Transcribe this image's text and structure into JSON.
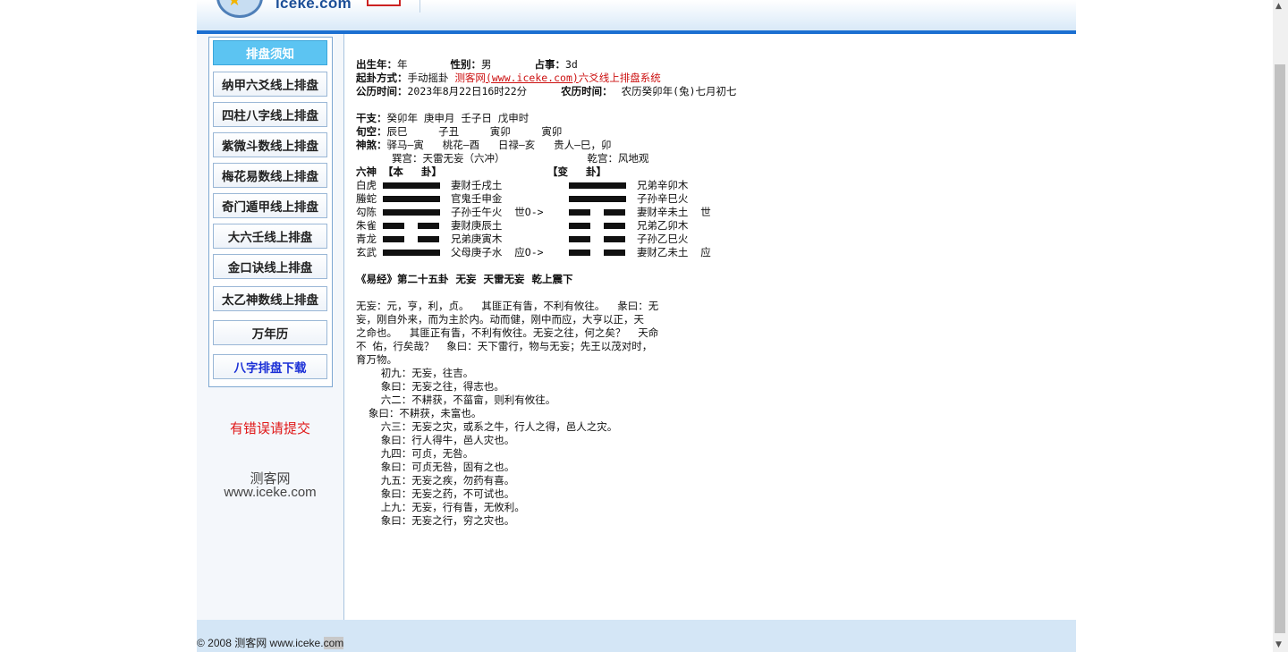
{
  "header": {
    "logo_text": "iceke.com"
  },
  "sidebar": {
    "nav": [
      {
        "label": "排盘须知"
      },
      {
        "label": "纳甲六爻线上排盘"
      },
      {
        "label": "四柱八字线上排盘"
      },
      {
        "label": "紫微斗数线上排盘"
      },
      {
        "label": "梅花易数线上排盘"
      },
      {
        "label": "奇门遁甲线上排盘"
      },
      {
        "label": "大六壬线上排盘"
      },
      {
        "label": "金口诀线上排盘"
      },
      {
        "label": "太乙神数线上排盘"
      },
      {
        "label": "万年历"
      },
      {
        "label": "八字排盘下载"
      }
    ],
    "report_link": "有错误请提交",
    "site_name": "测客网",
    "site_url": "www.iceke.com"
  },
  "info": {
    "birth_year_label": "出生年：",
    "birth_year": "年",
    "gender_label": "性别：",
    "gender": "男",
    "matter_label": "占事：",
    "matter": "3d",
    "method_label": "起卦方式：",
    "method": "手动摇卦",
    "system_prefix": "测客网",
    "system_url": "(www.iceke.com)",
    "system_suffix": "六爻线上排盘系统",
    "solar_label": "公历时间：",
    "solar": "2023年8月22日16时22分",
    "lunar_label": "农历时间：",
    "lunar": "农历癸卯年(兔)七月初七",
    "ganzhi_label": "干支：",
    "ganzhi": "癸卯年 庚申月 壬子日 戊申时",
    "xunkong_label": "旬空：",
    "xunkong": "辰巳     子丑     寅卯     寅卯",
    "shensha_label": "神煞：",
    "shensha": "驿马—寅   桃花—酉   日禄—亥   贵人—巳，卯",
    "palace_main": "巽宫：天雷无妄（六冲）",
    "palace_changed": "乾宫：风地观"
  },
  "hexagram": {
    "col_liushen": "六神",
    "col_ben": "【本     卦】",
    "col_bian": "【变     卦】",
    "lines": [
      {
        "god": "白虎",
        "ben": "妻财壬戌土",
        "bian": "兄弟辛卯木",
        "mark": ""
      },
      {
        "god": "螣蛇",
        "ben": "官鬼壬申金",
        "bian": "子孙辛巳火",
        "mark": ""
      },
      {
        "god": "勾陈",
        "ben": "子孙壬午火  世O->",
        "bian": "妻财辛未土",
        "mark": "世"
      },
      {
        "god": "朱雀",
        "ben": "妻财庚辰土",
        "bian": "兄弟乙卯木",
        "mark": ""
      },
      {
        "god": "青龙",
        "ben": "兄弟庚寅木",
        "bian": "子孙乙巳火",
        "mark": ""
      },
      {
        "god": "玄武",
        "ben": "父母庚子水  应O->",
        "bian": "妻财乙未土",
        "mark": "应"
      }
    ]
  },
  "classic": {
    "title": "《易经》第二十五卦  无妄  天雷无妄  乾上震下",
    "paragraph": [
      "无妄：元，亨，利，贞。  其匪正有眚，不利有攸往。  彖曰：无",
      "妄，刚自外来，而为主於内。动而健，刚中而应，大亨以正，天",
      "之命也。  其匪正有眚，不利有攸往。无妄之往，何之矣？  天命",
      "不 佑，行矣哉？  象曰：天下雷行，物与无妄；先王以茂对时，",
      "育万物。"
    ],
    "yao": [
      "    初九：无妄，往吉。",
      "    象曰：无妄之往，得志也。",
      "    六二：不耕获，不菑畲，则利有攸往。",
      "  象曰：不耕获，未富也。",
      "    六三：无妄之灾，或系之牛，行人之得，邑人之灾。",
      "    象曰：行人得牛，邑人灾也。",
      "    九四：可贞，无咎。",
      "    象曰：可贞无咎，固有之也。",
      "    九五：无妄之疾，勿药有喜。",
      "    象曰：无妄之药，不可试也。",
      "    上九：无妄，行有眚，无攸利。",
      "    象曰：无妄之行，穷之灾也。"
    ]
  },
  "footer": {
    "text": "© 2008 测客网 www.iceke.",
    "highlight": "com"
  }
}
